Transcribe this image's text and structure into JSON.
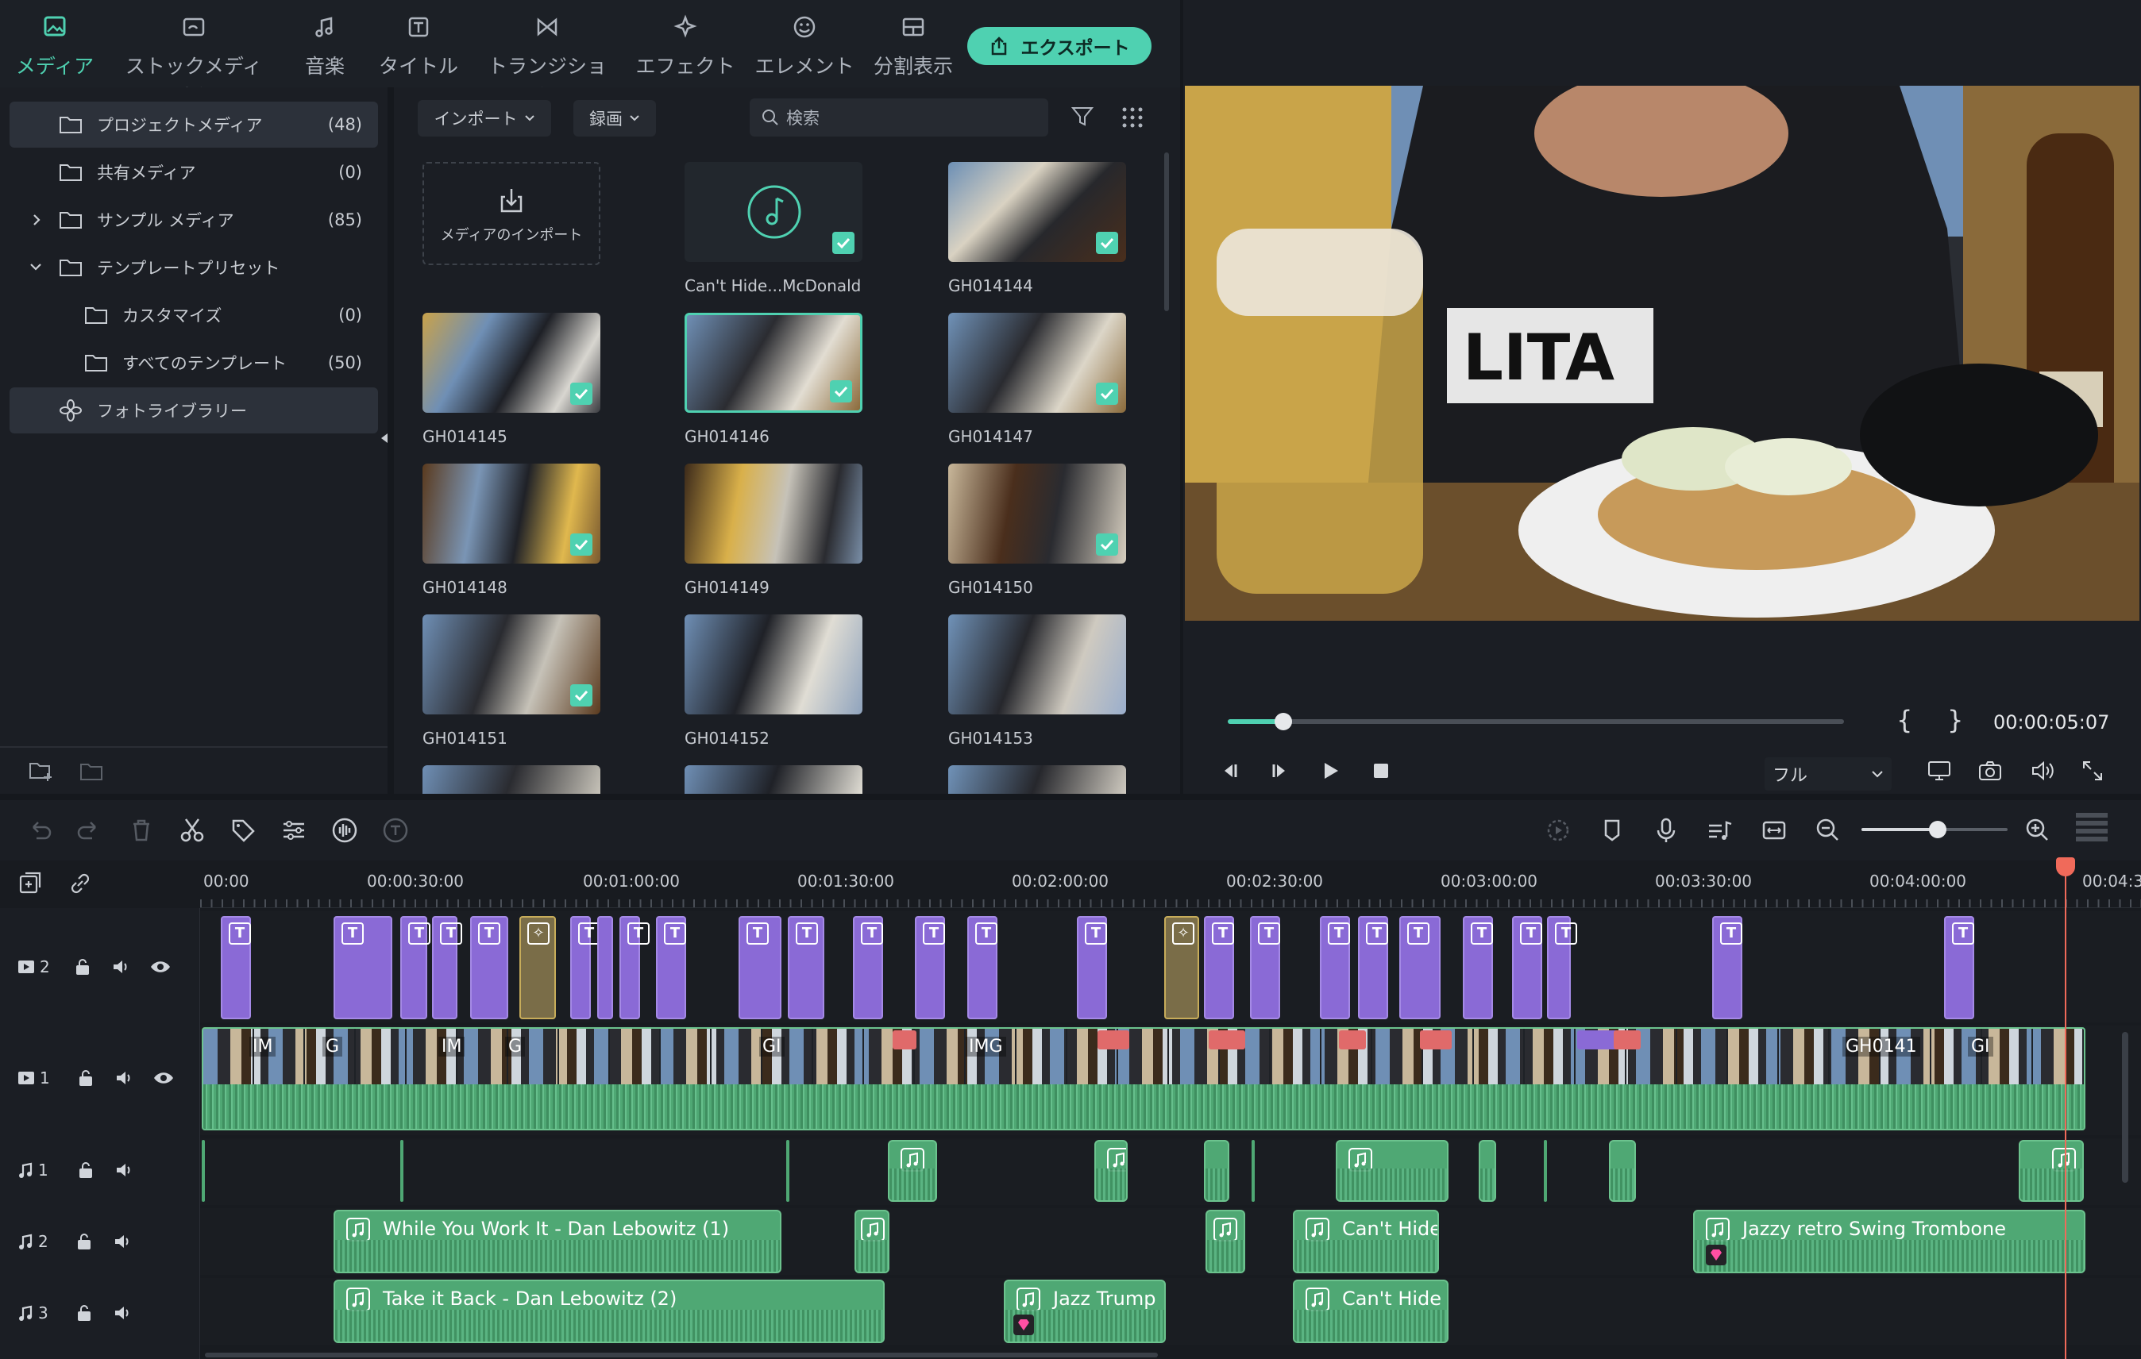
{
  "tabs": [
    {
      "label": "メディア",
      "icon": "media-icon",
      "active": true
    },
    {
      "label": "ストックメディア",
      "icon": "stock-media-icon"
    },
    {
      "label": "音楽",
      "icon": "music-icon"
    },
    {
      "label": "タイトル",
      "icon": "title-icon"
    },
    {
      "label": "トランジション",
      "icon": "transition-icon"
    },
    {
      "label": "エフェクト",
      "icon": "effect-icon"
    },
    {
      "label": "エレメント",
      "icon": "element-icon"
    },
    {
      "label": "分割表示",
      "icon": "split-screen-icon"
    }
  ],
  "export_label": "エクスポート",
  "sidebar": {
    "items": [
      {
        "label": "プロジェクトメディア",
        "count": "(48)"
      },
      {
        "label": "共有メディア",
        "count": "(0)"
      },
      {
        "label": "サンプル メディア",
        "count": "(85)"
      },
      {
        "label": "テンプレートプリセット",
        "count": ""
      },
      {
        "label": "カスタマイズ",
        "count": "(0)"
      },
      {
        "label": "すべてのテンプレート",
        "count": "(50)"
      },
      {
        "label": "フォトライブラリー",
        "count": ""
      }
    ]
  },
  "media_toolbar": {
    "import": "インポート",
    "record": "録画",
    "search_placeholder": "検索"
  },
  "media": {
    "import_tile": "メディアのインポート",
    "items": [
      "Can't Hide...McDonald",
      "GH014144",
      "GH014145",
      "GH014146",
      "GH014147",
      "GH014148",
      "GH014149",
      "GH014150",
      "GH014151",
      "GH014152",
      "GH014153"
    ]
  },
  "preview": {
    "timecode": "00:00:05:07",
    "quality": "フル",
    "progress": 0.09
  },
  "timeline": {
    "ruler": [
      "00:00",
      "00:00:30:00",
      "00:01:00:00",
      "00:01:30:00",
      "00:02:00:00",
      "00:02:30:00",
      "00:03:00:00",
      "00:03:30:00",
      "00:04:00:00",
      "00:04:3"
    ],
    "tracks": {
      "v2": "2",
      "v1": "1",
      "a1": "1",
      "a2": "2",
      "a3": "3"
    },
    "video_labels": [
      "IM",
      "G",
      "IM",
      "G",
      "GI",
      "IMG",
      "GH0141",
      "GI"
    ],
    "audio": {
      "a2_1": "While You Work It - Dan Lebowitz (1)",
      "a2_2": "Can't Hide",
      "a2_3": "Jazzy retro Swing Trombone",
      "a3_1": "Take it Back - Dan Lebowitz (2)",
      "a3_2": "Jazz Trump",
      "a3_3": "Can't Hide"
    },
    "zoom": 0.52
  }
}
